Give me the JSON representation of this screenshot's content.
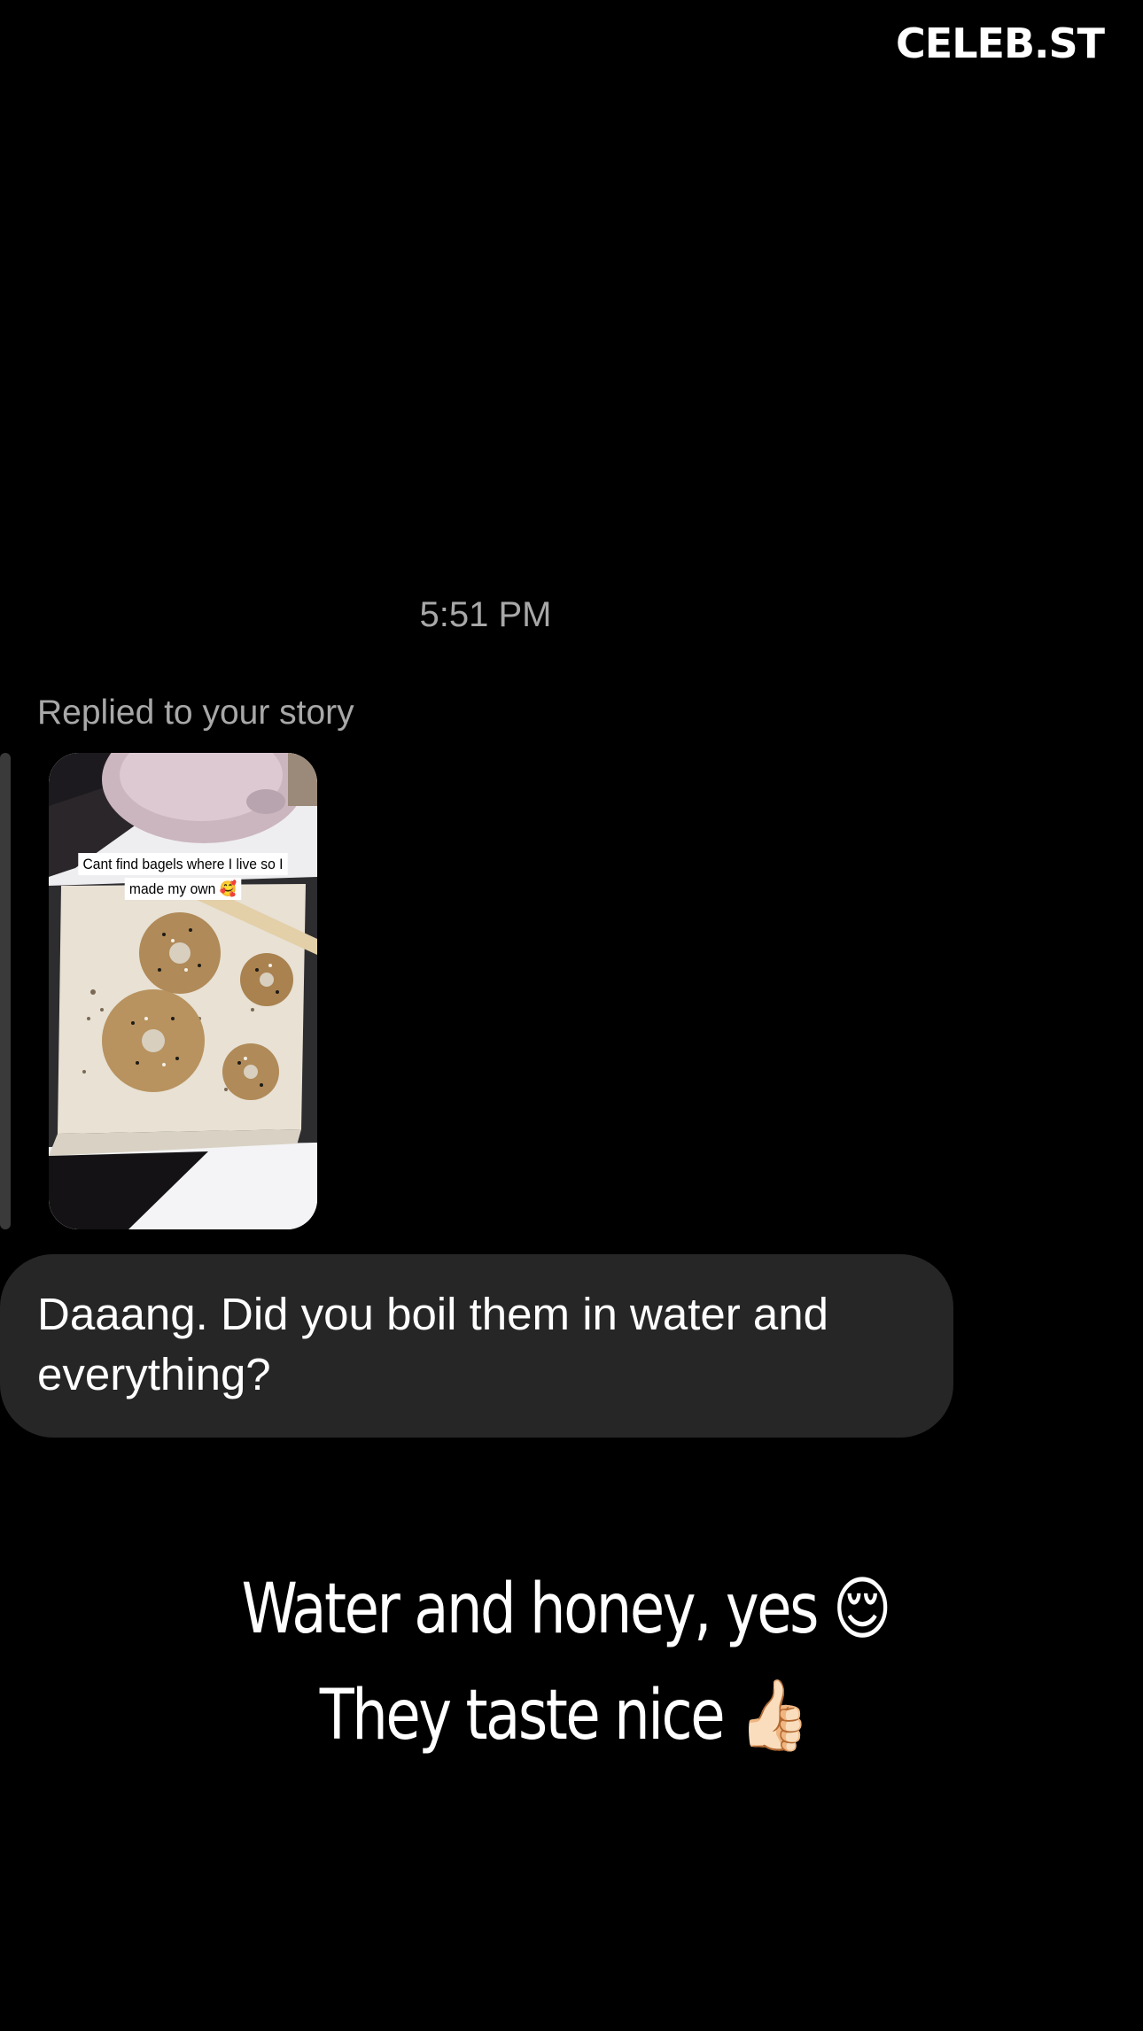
{
  "watermark": "CELEB.ST",
  "conversation": {
    "timestamp": "5:51 PM",
    "reply_label": "Replied to your story",
    "story": {
      "caption": "Cant find bagels where I live so I made my own 🥰"
    },
    "message": "Daaang. Did you boil them in water and everything?"
  },
  "overlay": {
    "line1": "Water and honey, yes",
    "line1_emoji": "😌",
    "line2": "They taste nice",
    "line2_emoji": "👍🏻"
  }
}
